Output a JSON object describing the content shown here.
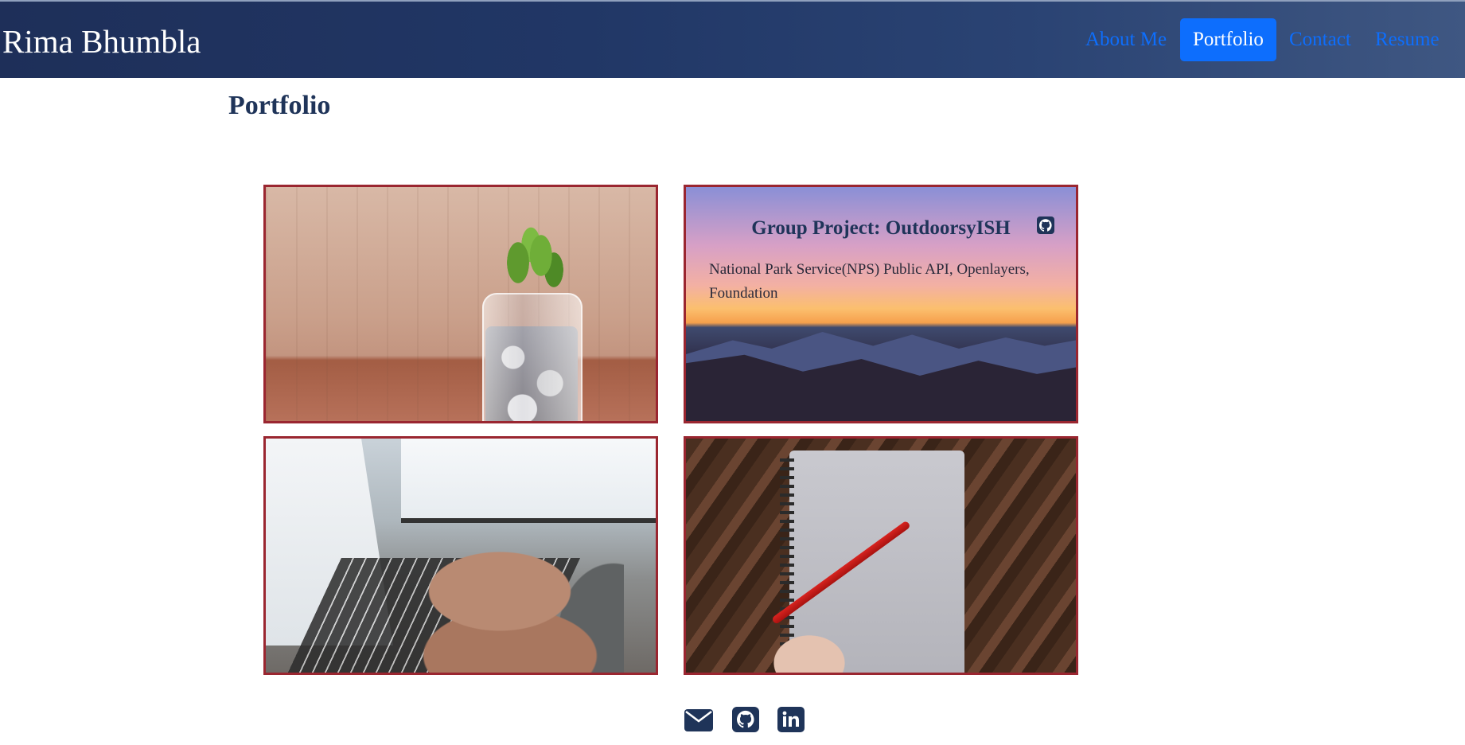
{
  "navbar": {
    "brand": "Rima Bhumbla",
    "links": [
      {
        "label": "About Me",
        "active": false
      },
      {
        "label": "Portfolio",
        "active": true
      },
      {
        "label": "Contact",
        "active": false
      },
      {
        "label": "Resume",
        "active": false
      }
    ]
  },
  "main": {
    "title": "Portfolio",
    "projects": [
      {
        "image": "jar-of-coins-with-plant"
      },
      {
        "image": "sunset-mountains",
        "title": "Group Project: OutdoorsyISH",
        "description": "National Park Service(NPS) Public API, Openlayers, Foundation",
        "icon": "github-icon"
      },
      {
        "image": "hands-typing-on-laptop"
      },
      {
        "image": "notebook-and-red-pen"
      }
    ]
  },
  "footer": {
    "icons": [
      "envelope-icon",
      "github-icon",
      "linkedin-icon"
    ]
  },
  "colors": {
    "accent": "#0d6efd",
    "navy": "#1f3459",
    "card_border": "#9a2630"
  }
}
